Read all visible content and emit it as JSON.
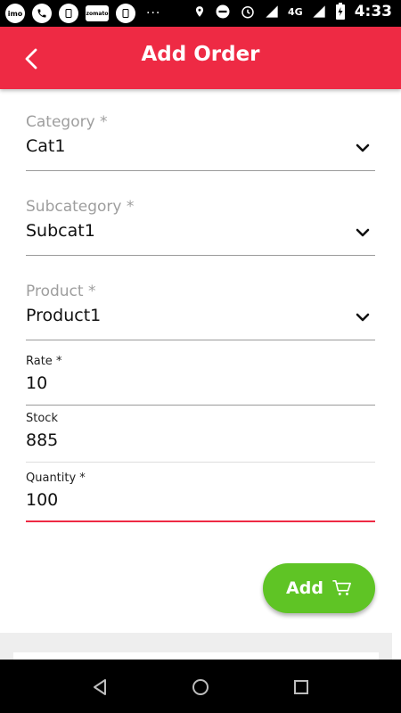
{
  "status_bar": {
    "left_icons": [
      "imo",
      "phone",
      "notif",
      "zomato",
      "notif2"
    ],
    "left_labels": {
      "imo": "imo",
      "zomato": "zomato"
    },
    "more": "···",
    "network": "4G",
    "time": "4:33"
  },
  "header": {
    "title": "Add Order"
  },
  "form": {
    "category": {
      "label": "Category *",
      "value": "Cat1"
    },
    "subcategory": {
      "label": "Subcategory *",
      "value": "Subcat1"
    },
    "product": {
      "label": "Product *",
      "value": "Product1"
    },
    "rate": {
      "label": "Rate *",
      "value": "10"
    },
    "stock": {
      "label": "Stock",
      "value": "885"
    },
    "quantity": {
      "label": "Quantity *",
      "value": "100"
    }
  },
  "add_button": {
    "label": "Add"
  },
  "colors": {
    "primary": "#ee2a44",
    "accent_green": "#5fc425",
    "active_underline": "#ee2a44"
  },
  "icons": {
    "back": "back-arrow-icon",
    "dropdown": "chevron-down-icon",
    "cart": "cart-icon"
  }
}
